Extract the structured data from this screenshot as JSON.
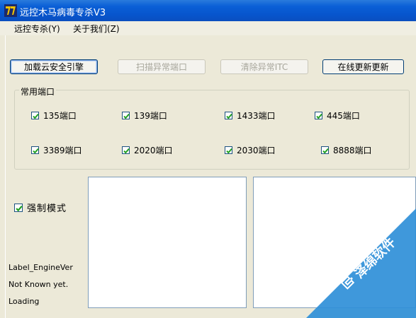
{
  "window": {
    "title": "远控木马病毒专杀V3"
  },
  "menu": [
    {
      "label": "远控专杀(Y)"
    },
    {
      "label": "关于我们(Z)"
    }
  ],
  "buttons": {
    "load_engine": "加载云安全引擎",
    "scan_ports": "扫描异常端口",
    "clear_itc": "清除异常ITC",
    "online_update": "在线更新更新"
  },
  "group": {
    "legend": "常用端口",
    "ports": [
      "135端口",
      "139端口",
      "1433端口",
      "445端口",
      "3389端口",
      "2020端口",
      "2030端口",
      "8888端口"
    ]
  },
  "force_mode": "强制模式",
  "labels": {
    "engine_ver": "Label_EngineVer",
    "not_known": "Not Known yet.",
    "loading": "Loading"
  },
  "watermark": "泽绵软件",
  "colors": {
    "titlebar": "#0a5fd6",
    "watermark": "#2f8fd8"
  }
}
